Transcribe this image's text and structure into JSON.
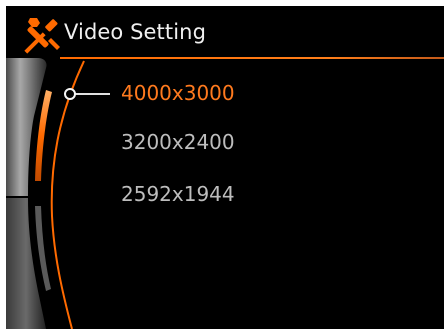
{
  "header": {
    "title": "Video Setting",
    "icon": "tools-icon"
  },
  "menu": {
    "items": [
      {
        "label": "4000x3000",
        "selected": true
      },
      {
        "label": "3200x2400",
        "selected": false
      },
      {
        "label": "2592x1944",
        "selected": false
      }
    ]
  },
  "colors": {
    "accent": "#ff7a1e",
    "background": "#000000",
    "text_normal": "#bdbdbd",
    "text_title": "#f0f0f0"
  }
}
